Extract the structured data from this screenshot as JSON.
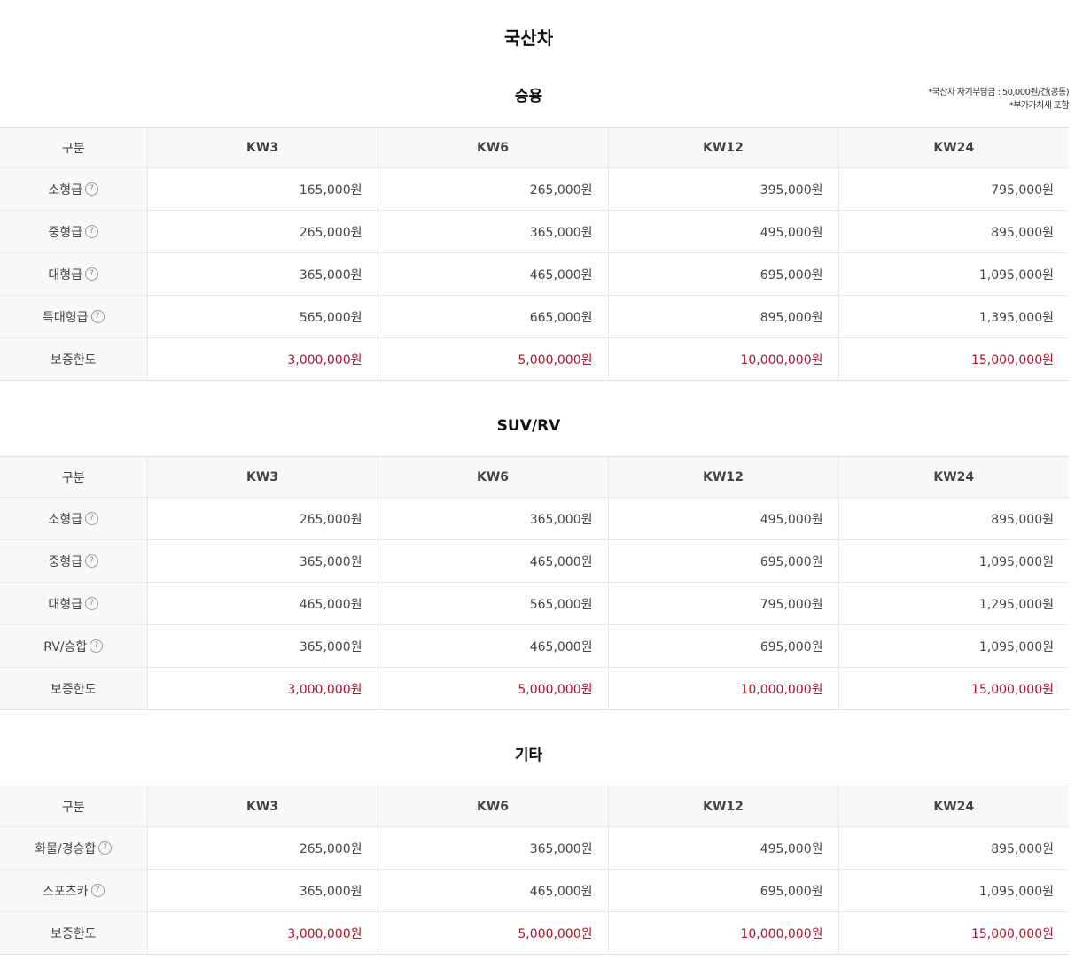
{
  "page_title": "국산차",
  "notes": [
    "*국산차 자기부담금 : 50,000원/건(공통)",
    "*부가가치세 포함"
  ],
  "help_icon": {
    "glyph": "?",
    "name": "question-circle-icon"
  },
  "colors": {
    "limit_value": "#b0112a",
    "header_bg": "#f7f8f9"
  },
  "sections": [
    {
      "title": "승용",
      "columns": [
        "구분",
        "KW3",
        "KW6",
        "KW12",
        "KW24"
      ],
      "rows": [
        {
          "label": "소형급",
          "help": true,
          "values": [
            "165,000원",
            "265,000원",
            "395,000원",
            "795,000원"
          ]
        },
        {
          "label": "중형급",
          "help": true,
          "values": [
            "265,000원",
            "365,000원",
            "495,000원",
            "895,000원"
          ]
        },
        {
          "label": "대형급",
          "help": true,
          "values": [
            "365,000원",
            "465,000원",
            "695,000원",
            "1,095,000원"
          ]
        },
        {
          "label": "특대형급",
          "help": true,
          "values": [
            "565,000원",
            "665,000원",
            "895,000원",
            "1,395,000원"
          ]
        },
        {
          "label": "보증한도",
          "help": false,
          "limit": true,
          "values": [
            "3,000,000원",
            "5,000,000원",
            "10,000,000원",
            "15,000,000원"
          ]
        }
      ]
    },
    {
      "title": "SUV/RV",
      "columns": [
        "구분",
        "KW3",
        "KW6",
        "KW12",
        "KW24"
      ],
      "rows": [
        {
          "label": "소형급",
          "help": true,
          "values": [
            "265,000원",
            "365,000원",
            "495,000원",
            "895,000원"
          ]
        },
        {
          "label": "중형급",
          "help": true,
          "values": [
            "365,000원",
            "465,000원",
            "695,000원",
            "1,095,000원"
          ]
        },
        {
          "label": "대형급",
          "help": true,
          "values": [
            "465,000원",
            "565,000원",
            "795,000원",
            "1,295,000원"
          ]
        },
        {
          "label": "RV/승합",
          "help": true,
          "values": [
            "365,000원",
            "465,000원",
            "695,000원",
            "1,095,000원"
          ]
        },
        {
          "label": "보증한도",
          "help": false,
          "limit": true,
          "values": [
            "3,000,000원",
            "5,000,000원",
            "10,000,000원",
            "15,000,000원"
          ]
        }
      ]
    },
    {
      "title": "기타",
      "columns": [
        "구분",
        "KW3",
        "KW6",
        "KW12",
        "KW24"
      ],
      "rows": [
        {
          "label": "화물/경승합",
          "help": true,
          "values": [
            "265,000원",
            "365,000원",
            "495,000원",
            "895,000원"
          ]
        },
        {
          "label": "스포츠카",
          "help": true,
          "values": [
            "365,000원",
            "465,000원",
            "695,000원",
            "1,095,000원"
          ]
        },
        {
          "label": "보증한도",
          "help": false,
          "limit": true,
          "values": [
            "3,000,000원",
            "5,000,000원",
            "10,000,000원",
            "15,000,000원"
          ]
        }
      ]
    }
  ]
}
